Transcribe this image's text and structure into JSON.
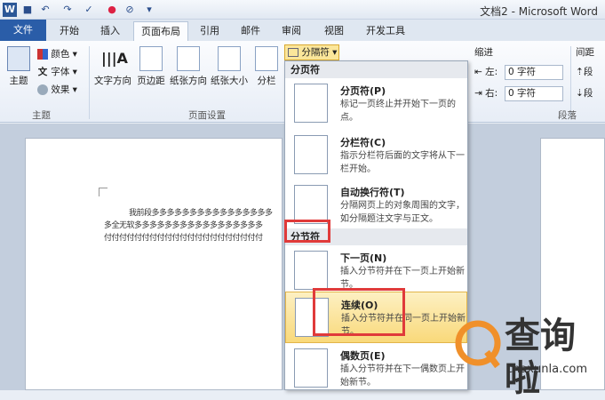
{
  "window": {
    "title": "文档2 - Microsoft Word"
  },
  "quick_access": [
    "word-app-icon",
    "save-icon",
    "undo-icon",
    "redo-icon",
    "format-painter-icon",
    "color-icon",
    "clear-icon",
    "customize-icon"
  ],
  "tabs": [
    "文件",
    "开始",
    "插入",
    "页面布局",
    "引用",
    "邮件",
    "审阅",
    "视图",
    "开发工具"
  ],
  "active_tab": "页面布局",
  "ribbon": {
    "theme_group": {
      "label": "主题",
      "theme_btn": "主题",
      "colors": "颜色",
      "fonts": "字体",
      "effects": "效果"
    },
    "page_setup_group": {
      "label": "页面设置",
      "buttons": [
        "文字方向",
        "页边距",
        "纸张方向",
        "纸张大小",
        "分栏"
      ]
    },
    "breaks_btn": "分隔符",
    "indent": {
      "title": "缩进",
      "left_label": "左:",
      "left_value": "0 字符",
      "right_label": "右:",
      "right_value": "0 字符"
    },
    "spacing": {
      "title": "间距",
      "before": "段",
      "after": "段"
    },
    "paragraph_label": "段落"
  },
  "document": {
    "lines": [
      "我前段多多多多多多多多多多多多多多多多",
      "多全无软多多多多多多多多多多多多多多多多多",
      "付付付付付付付付付付付付付付付付付付付付付"
    ]
  },
  "dropdown": {
    "page_breaks_header": "分页符",
    "section_breaks_header": "分节符",
    "items": [
      {
        "title": "分页符(P)",
        "desc": "标记一页终止并开始下一页的点。"
      },
      {
        "title": "分栏符(C)",
        "desc": "指示分栏符后面的文字将从下一栏开始。"
      },
      {
        "title": "自动换行符(T)",
        "desc": "分隔网页上的对象周围的文字，如分隔题注文字与正文。"
      },
      {
        "title": "下一页(N)",
        "desc": "插入分节符并在下一页上开始新节。"
      },
      {
        "title": "连续(O)",
        "desc": "插入分节符并在同一页上开始新节。"
      },
      {
        "title": "偶数页(E)",
        "desc": "插入分节符并在下一偶数页上开始新节。"
      }
    ]
  },
  "watermark": {
    "brand": "查询啦",
    "url": "chaxunla.com"
  },
  "colors": {
    "file_tab": "#2a5da8",
    "highlight": "#f9d97a",
    "annotation": "#e03a3a",
    "watermark": "#f0902a"
  }
}
